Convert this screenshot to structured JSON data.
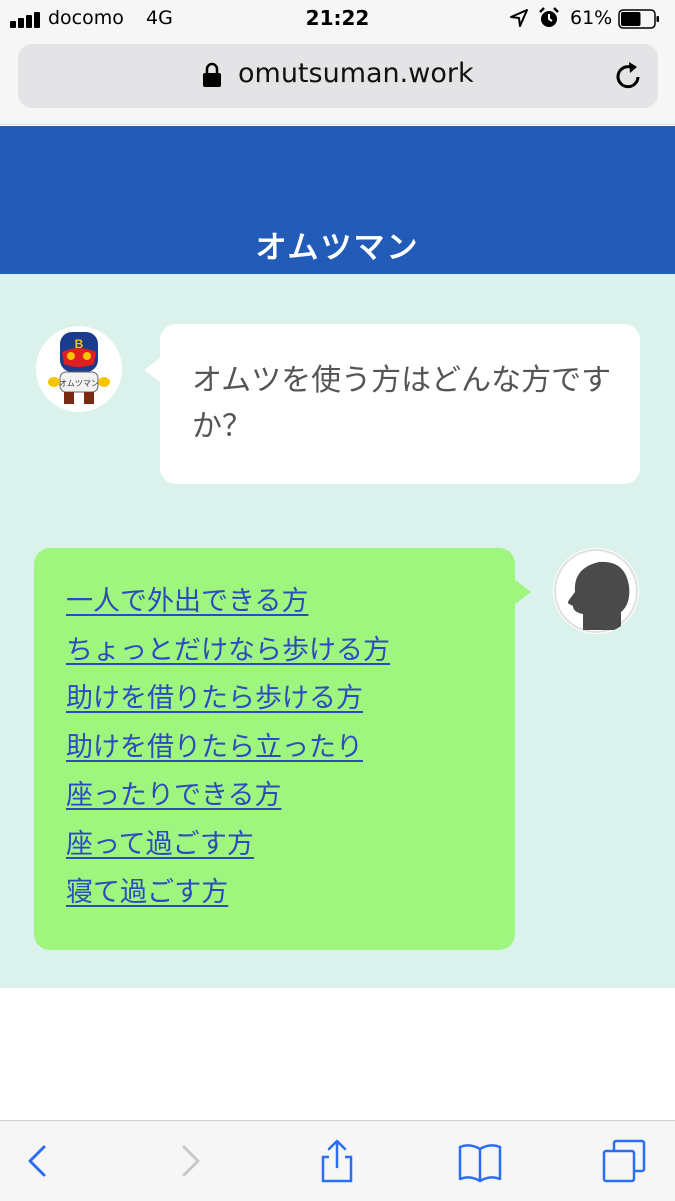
{
  "status_bar": {
    "carrier": "docomo",
    "network": "4G",
    "time": "21:22",
    "battery": "61%",
    "battery_level": 0.61
  },
  "browser": {
    "url": "omutsuman.work"
  },
  "header": {
    "title": "オムツマン",
    "color": "#235bb8"
  },
  "chat": {
    "bot_question": "オムツを使う方はどんな方ですか？",
    "bot_avatar_text": "オムツマン",
    "options": [
      "一人で外出できる方",
      "ちょっとだけなら歩ける方",
      "助けを借りたら歩ける方",
      "助けを借りたら立ったり",
      "座ったりできる方",
      "座って過ごす方",
      "寝て過ごす方"
    ],
    "colors": {
      "chat_background": "#dbf1ec",
      "user_bubble": "#9ef67e",
      "link": "#2b4bbf"
    }
  },
  "toolbar": {
    "icons": [
      "back-icon",
      "forward-icon",
      "share-icon",
      "bookmarks-icon",
      "tabs-icon"
    ]
  }
}
